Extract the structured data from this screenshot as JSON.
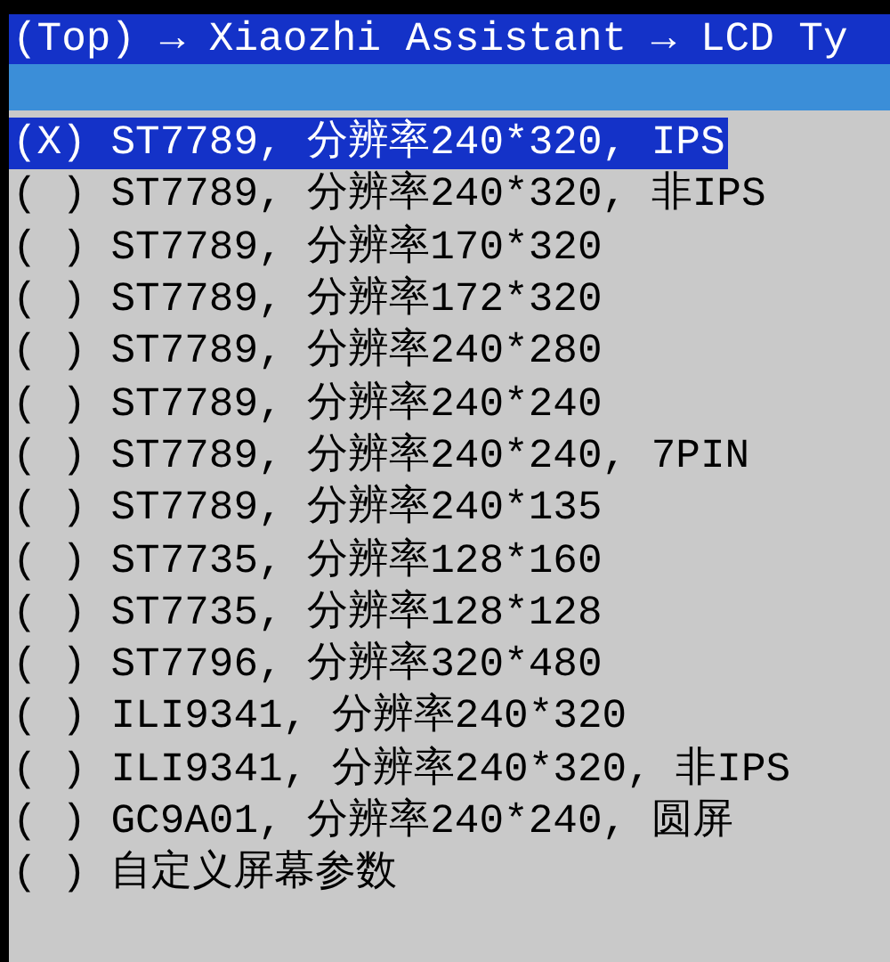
{
  "title": "(Top) → Xiaozhi Assistant → LCD Ty",
  "items": [
    {
      "label": "(X) ST7789, 分辨率240*320, IPS",
      "selected": true
    },
    {
      "label": "( ) ST7789, 分辨率240*320, 非IPS",
      "selected": false
    },
    {
      "label": "( ) ST7789, 分辨率170*320",
      "selected": false
    },
    {
      "label": "( ) ST7789, 分辨率172*320",
      "selected": false
    },
    {
      "label": "( ) ST7789, 分辨率240*280",
      "selected": false
    },
    {
      "label": "( ) ST7789, 分辨率240*240",
      "selected": false
    },
    {
      "label": "( ) ST7789, 分辨率240*240, 7PIN",
      "selected": false
    },
    {
      "label": "( ) ST7789, 分辨率240*135",
      "selected": false
    },
    {
      "label": "( ) ST7735, 分辨率128*160",
      "selected": false
    },
    {
      "label": "( ) ST7735, 分辨率128*128",
      "selected": false
    },
    {
      "label": "( ) ST7796, 分辨率320*480",
      "selected": false
    },
    {
      "label": "( ) ILI9341, 分辨率240*320",
      "selected": false
    },
    {
      "label": "( ) ILI9341, 分辨率240*320, 非IPS",
      "selected": false
    },
    {
      "label": "( ) GC9A01, 分辨率240*240, 圆屏",
      "selected": false
    },
    {
      "label": "( ) 自定义屏幕参数",
      "selected": false
    }
  ]
}
